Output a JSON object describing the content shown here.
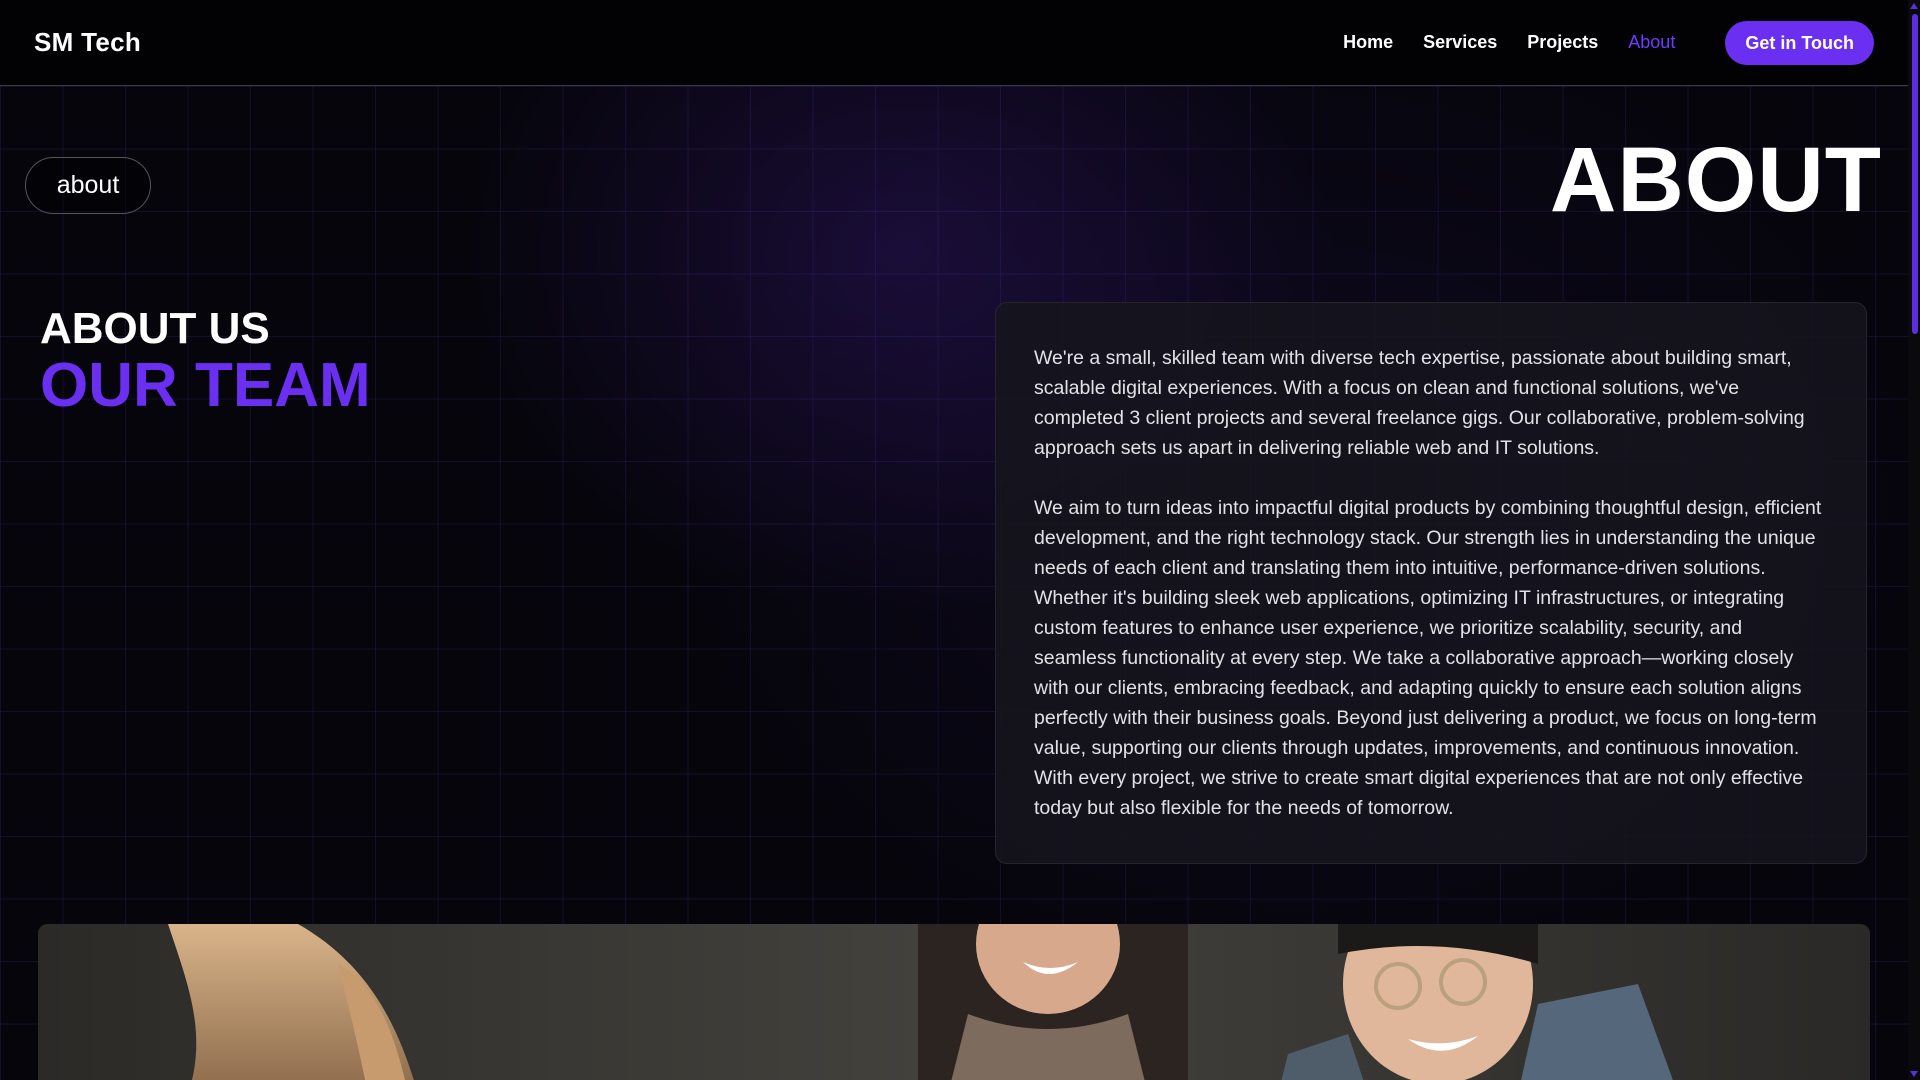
{
  "header": {
    "logo": "SM Tech",
    "nav": [
      {
        "label": "Home",
        "active": false
      },
      {
        "label": "Services",
        "active": false
      },
      {
        "label": "Projects",
        "active": false
      },
      {
        "label": "About",
        "active": true
      }
    ],
    "cta_label": "Get in Touch"
  },
  "hero": {
    "pill_label": "about",
    "big_title": "ABOUT"
  },
  "section": {
    "heading": "ABOUT US",
    "subheading": "OUR TEAM"
  },
  "card": {
    "paragraph1": "We're a small, skilled team with diverse tech expertise, passionate about building smart, scalable digital experiences. With a focus on clean and functional solutions, we've completed 3 client projects and several freelance gigs. Our collaborative, problem-solving approach sets us apart in delivering reliable web and IT solutions.",
    "paragraph2": "We aim to turn ideas into impactful digital products by combining thoughtful design, efficient development, and the right technology stack. Our strength lies in understanding the unique needs of each client and translating them into intuitive, performance-driven solutions. Whether it's building sleek web applications, optimizing IT infrastructures, or integrating custom features to enhance user experience, we prioritize scalability, security, and seamless functionality at every step. We take a collaborative approach—working closely with our clients, embracing feedback, and adapting quickly to ensure each solution aligns perfectly with their business goals. Beyond just delivering a product, we focus on long-term value, supporting our clients through updates, improvements, and continuous innovation. With every project, we strive to create smart digital experiences that are not only effective today but also flexible for the needs of tomorrow."
  },
  "colors": {
    "accent": "#6a2ff0",
    "background": "#06050c",
    "card": "#16151c",
    "text": "#ffffff"
  },
  "icons": [
    "scroll-up-arrow-icon",
    "scroll-down-arrow-icon"
  ]
}
